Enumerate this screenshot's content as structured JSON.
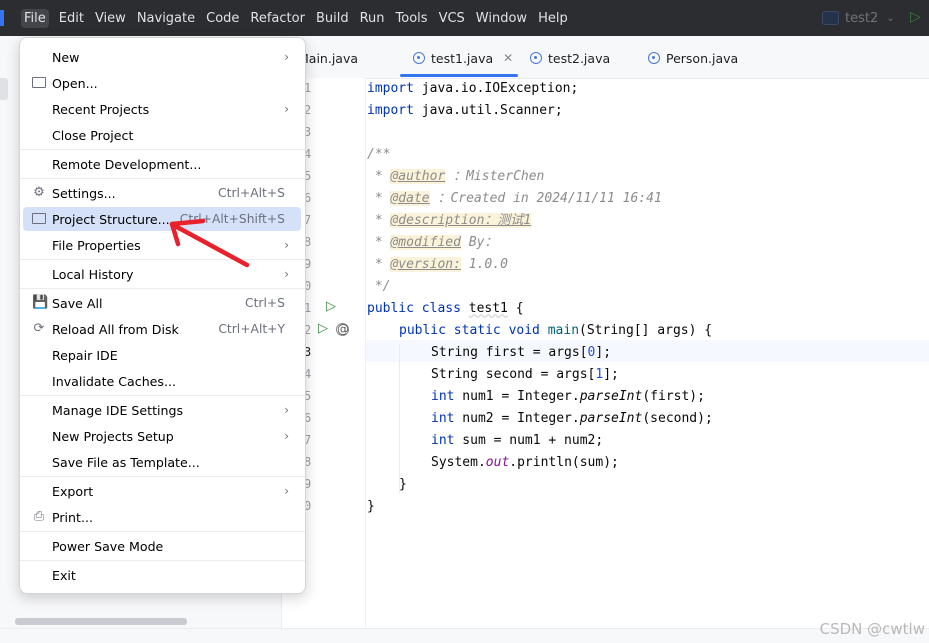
{
  "menubar": {
    "items": [
      {
        "label": "File",
        "active": true
      },
      {
        "label": "Edit"
      },
      {
        "label": "View"
      },
      {
        "label": "Navigate"
      },
      {
        "label": "Code"
      },
      {
        "label": "Refactor"
      },
      {
        "label": "Build"
      },
      {
        "label": "Run"
      },
      {
        "label": "Tools"
      },
      {
        "label": "VCS"
      },
      {
        "label": "Window"
      },
      {
        "label": "Help"
      }
    ],
    "project_name": "test2"
  },
  "tabs": [
    {
      "label": "Main.java",
      "active": false
    },
    {
      "label": "test1.java",
      "active": true
    },
    {
      "label": "test2.java",
      "active": false
    },
    {
      "label": "Person.java",
      "active": false
    }
  ],
  "file_menu": {
    "items": [
      {
        "label": "New",
        "shortcut": "",
        "submenu": true
      },
      {
        "label": "Open...",
        "shortcut": "",
        "icon": "folder-icon"
      },
      {
        "label": "Recent Projects",
        "shortcut": "",
        "submenu": true
      },
      {
        "label": "Close Project",
        "shortcut": ""
      },
      {
        "label": "Remote Development...",
        "shortcut": ""
      },
      {
        "label": "Settings...",
        "shortcut": "Ctrl+Alt+S",
        "icon": "gear-icon"
      },
      {
        "label": "Project Structure...",
        "shortcut": "Ctrl+Alt+Shift+S",
        "icon": "project-structure-icon",
        "selected": true
      },
      {
        "label": "File Properties",
        "shortcut": "",
        "submenu": true
      },
      {
        "label": "Local History",
        "shortcut": "",
        "submenu": true
      },
      {
        "label": "Save All",
        "shortcut": "Ctrl+S",
        "icon": "save-icon"
      },
      {
        "label": "Reload All from Disk",
        "shortcut": "Ctrl+Alt+Y",
        "icon": "reload-icon"
      },
      {
        "label": "Repair IDE",
        "shortcut": ""
      },
      {
        "label": "Invalidate Caches...",
        "shortcut": ""
      },
      {
        "label": "Manage IDE Settings",
        "shortcut": "",
        "submenu": true
      },
      {
        "label": "New Projects Setup",
        "shortcut": "",
        "submenu": true
      },
      {
        "label": "Save File as Template...",
        "shortcut": ""
      },
      {
        "label": "Export",
        "shortcut": "",
        "submenu": true
      },
      {
        "label": "Print...",
        "shortcut": "",
        "icon": "print-icon"
      },
      {
        "label": "Power Save Mode",
        "shortcut": ""
      },
      {
        "label": "Exit",
        "shortcut": ""
      }
    ]
  },
  "gutter": {
    "line_numbers": [
      "1",
      "2",
      "3",
      "4",
      "5",
      "6",
      "7",
      "8",
      "9",
      "0",
      "1",
      "2",
      "3",
      "4",
      "5",
      "6",
      "7",
      "8",
      "9",
      "0"
    ]
  },
  "code": {
    "l1_kw": "import",
    "l1_rest": " java.io.IOException;",
    "l2_kw": "import",
    "l2_rest": " java.util.Scanner;",
    "l4": "/**",
    "l5_pre": " * ",
    "l5_tag": "@author",
    "l5_rest": " ：MisterChen",
    "l6_pre": " * ",
    "l6_tag": "@date",
    "l6_rest": " ：Created in 2024/11/11 16:41",
    "l7_pre": " * ",
    "l7_tag": "@description：测试1",
    "l8_pre": " * ",
    "l8_tag": "@modified",
    "l8_rest": " By：",
    "l9_pre": " * ",
    "l9_tag": "@version:",
    "l9_rest": " 1.0.0",
    "l10": " */",
    "l11_kw": "public class ",
    "l11_cls": "test1",
    "l11_rest": " {",
    "l12_kw": "public static void ",
    "l12_fn": "main",
    "l12_rest": "(String[] args) {",
    "l13_a": "String first = args[",
    "l13_n": "0",
    "l13_b": "];",
    "l14_a": "String second = args[",
    "l14_n": "1",
    "l14_b": "];",
    "l15_kw": "int",
    "l15_a": " num1 = Integer.",
    "l15_it": "parseInt",
    "l15_b": "(first);",
    "l16_kw": "int",
    "l16_a": " num2 = Integer.",
    "l16_it": "parseInt",
    "l16_b": "(second);",
    "l17_kw": "int",
    "l17_a": " sum = num1 + num2;",
    "l18_a": "System.",
    "l18_fld": "out",
    "l18_b": ".println(sum);",
    "l19": "}",
    "l20": "}"
  },
  "watermark": "CSDN @cwtlw"
}
